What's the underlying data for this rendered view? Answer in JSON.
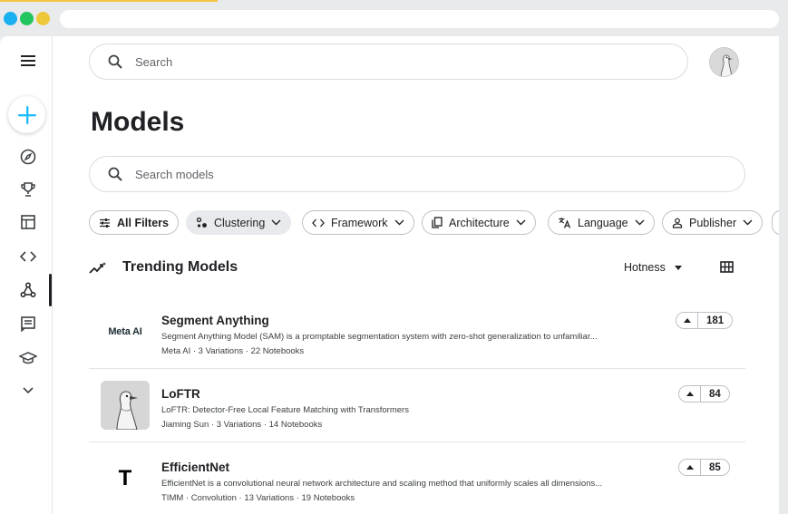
{
  "window": {
    "controls": [
      {
        "name": "window-close",
        "color": "#1ab0f0"
      },
      {
        "name": "window-minimize",
        "color": "#22c55e"
      },
      {
        "name": "window-zoom",
        "color": "#eec83b"
      }
    ]
  },
  "sidebar": {
    "items": [
      {
        "name": "menu-icon"
      },
      {
        "name": "create-icon"
      },
      {
        "name": "compass-icon"
      },
      {
        "name": "trophy-icon"
      },
      {
        "name": "table-icon"
      },
      {
        "name": "code-icon"
      },
      {
        "name": "models-icon"
      },
      {
        "name": "discussion-icon"
      },
      {
        "name": "school-icon"
      },
      {
        "name": "chevron-down-icon"
      }
    ],
    "active": "models-icon"
  },
  "header": {
    "search_placeholder": "Search",
    "avatar_icon": "goose-avatar"
  },
  "main": {
    "title": "Models",
    "model_search_placeholder": "Search models",
    "filters": [
      {
        "label": "All Filters",
        "icon": "sliders-icon",
        "bold": true
      },
      {
        "label": "Clustering",
        "icon": "clustering-icon",
        "dropdown": true,
        "selected": true
      },
      {
        "label": "Framework",
        "icon": "code-icon",
        "dropdown": true
      },
      {
        "label": "Architecture",
        "icon": "copy-icon",
        "dropdown": true
      },
      {
        "label": "Language",
        "icon": "translate-icon",
        "dropdown": true
      },
      {
        "label": "Publisher",
        "icon": "person-icon",
        "dropdown": true
      }
    ],
    "section": {
      "title": "Trending Models",
      "icon": "trending-icon",
      "sort_label": "Hotness",
      "view_icon": "grid-icon"
    },
    "models": [
      {
        "name": "Segment Anything",
        "logo": "Meta AI",
        "description": "Segment Anything Model (SAM) is a promptable segmentation system with zero-shot generalization to unfamiliar...",
        "meta": "Meta AI · 3 Variations · 22 Notebooks",
        "votes": "181"
      },
      {
        "name": "LoFTR",
        "logo": "goose-image",
        "description": "LoFTR: Detector-Free Local Feature Matching with Transformers",
        "meta": "Jiaming Sun · 3 Variations · 14 Notebooks",
        "votes": "84"
      },
      {
        "name": "EfficientNet",
        "logo": "T",
        "description": "EfficientNet is a convolutional neural network architecture and scaling method that uniformly scales all dimensions...",
        "meta": "TIMM · Convolution · 13 Variations · 19 Notebooks",
        "votes": "85"
      }
    ]
  }
}
